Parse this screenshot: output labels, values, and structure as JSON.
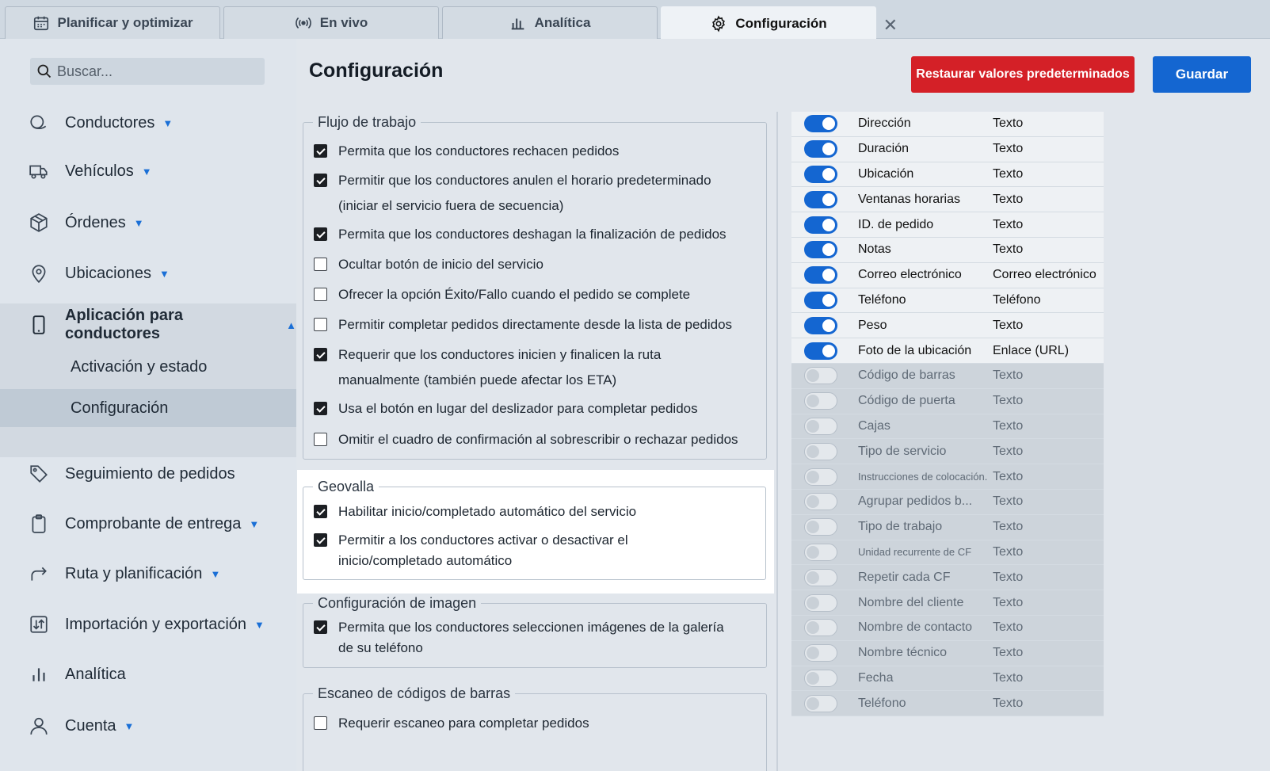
{
  "tabs": [
    {
      "label": "Planificar y optimizar",
      "icon": "calendar-icon"
    },
    {
      "label": "En vivo",
      "icon": "broadcast-icon"
    },
    {
      "label": "Analítica",
      "icon": "bar-chart-icon"
    },
    {
      "label": "Configuración",
      "icon": "gear-icon",
      "active": true
    }
  ],
  "search": {
    "placeholder": "Buscar..."
  },
  "sidebar": {
    "items": [
      {
        "label": "Conductores",
        "icon": "drivers-icon"
      },
      {
        "label": "Vehículos",
        "icon": "truck-icon"
      },
      {
        "label": "Órdenes",
        "icon": "box-icon"
      },
      {
        "label": "Ubicaciones",
        "icon": "location-pin-icon"
      },
      {
        "label": "Aplicación para conductores",
        "icon": "phone-icon",
        "expanded": true
      },
      {
        "label": "Seguimiento de pedidos",
        "icon": "tag-icon"
      },
      {
        "label": "Comprobante de entrega",
        "icon": "clipboard-icon"
      },
      {
        "label": "Ruta y planificación",
        "icon": "route-arrow-icon"
      },
      {
        "label": "Importación y exportación",
        "icon": "import-export-icon"
      },
      {
        "label": "Analítica",
        "icon": "bar-chart-icon"
      },
      {
        "label": "Cuenta",
        "icon": "user-icon"
      }
    ],
    "subitems": [
      "Activación y estado",
      "Configuración"
    ]
  },
  "main": {
    "title": "Configuración",
    "reset_label": "Restaurar valores predeterminados",
    "save_label": "Guardar"
  },
  "workflow": {
    "legend": "Flujo de trabajo",
    "options": [
      {
        "label": "Permita que los conductores rechacen pedidos",
        "checked": true
      },
      {
        "label": "Permitir que los conductores anulen el horario predeterminado (iniciar el servicio fuera de secuencia)",
        "checked": true
      },
      {
        "label": "Permita que los conductores deshagan la finalización de pedidos",
        "checked": true
      },
      {
        "label": "Ocultar botón de inicio del servicio",
        "checked": false
      },
      {
        "label": "Ofrecer la opción Éxito/Fallo cuando el pedido se complete",
        "checked": false
      },
      {
        "label": "Permitir completar pedidos directamente desde la lista de pedidos",
        "checked": false
      },
      {
        "label": "Requerir que los conductores inicien y finalicen la ruta manualmente (también puede afectar los ETA)",
        "checked": true
      },
      {
        "label": "Usa el botón en lugar del deslizador para completar pedidos",
        "checked": true
      },
      {
        "label": "Omitir el cuadro de confirmación al sobrescribir o rechazar pedidos",
        "checked": false
      }
    ]
  },
  "geofence": {
    "legend": "Geovalla",
    "options": [
      {
        "label": "Habilitar inicio/completado automático del servicio",
        "checked": true
      },
      {
        "label": "Permitir a los conductores activar o desactivar el inicio/completado automático",
        "checked": true
      }
    ]
  },
  "image": {
    "legend": "Configuración de imagen",
    "options": [
      {
        "label": "Permita que los conductores seleccionen imágenes de la galería de su teléfono",
        "checked": true
      }
    ]
  },
  "barcode": {
    "legend": "Escaneo de códigos de barras",
    "options": [
      {
        "label": "Requerir escaneo para completar pedidos",
        "checked": false
      }
    ]
  },
  "columns": [
    {
      "name": "Dirección",
      "type": "Texto",
      "enabled": true
    },
    {
      "name": "Duración",
      "type": "Texto",
      "enabled": true
    },
    {
      "name": "Ubicación",
      "type": "Texto",
      "enabled": true
    },
    {
      "name": "Ventanas horarias",
      "type": "Texto",
      "enabled": true
    },
    {
      "name": "ID. de pedido",
      "type": "Texto",
      "enabled": true
    },
    {
      "name": "Notas",
      "type": "Texto",
      "enabled": true
    },
    {
      "name": "Correo electrónico",
      "type": "Correo electrónico",
      "enabled": true
    },
    {
      "name": "Teléfono",
      "type": "Teléfono",
      "enabled": true
    },
    {
      "name": "Peso",
      "type": "Texto",
      "enabled": true
    },
    {
      "name": "Foto de la ubicación",
      "type": "Enlace (URL)",
      "enabled": true
    },
    {
      "name": "Código de barras",
      "type": "Texto",
      "enabled": false
    },
    {
      "name": "Código de puerta",
      "type": "Texto",
      "enabled": false
    },
    {
      "name": "Cajas",
      "type": "Texto",
      "enabled": false
    },
    {
      "name": "Tipo de servicio",
      "type": "Texto",
      "enabled": false
    },
    {
      "name": "Instrucciones de colocación...",
      "type": "Texto",
      "enabled": false,
      "small": true
    },
    {
      "name": "Agrupar pedidos b...",
      "type": "Texto",
      "enabled": false
    },
    {
      "name": "Tipo de trabajo",
      "type": "Texto",
      "enabled": false
    },
    {
      "name": "Unidad recurrente de CF",
      "type": "Texto",
      "enabled": false,
      "small": true
    },
    {
      "name": "Repetir cada CF",
      "type": "Texto",
      "enabled": false
    },
    {
      "name": "Nombre del cliente",
      "type": "Texto",
      "enabled": false
    },
    {
      "name": "Nombre de contacto",
      "type": "Texto",
      "enabled": false
    },
    {
      "name": "Nombre técnico",
      "type": "Texto",
      "enabled": false
    },
    {
      "name": "Fecha",
      "type": "Texto",
      "enabled": false
    },
    {
      "name": "Teléfono",
      "type": "Texto",
      "enabled": false
    }
  ]
}
